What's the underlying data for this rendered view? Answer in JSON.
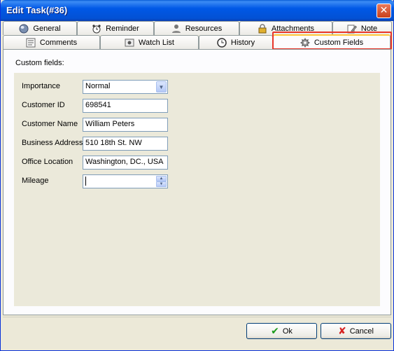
{
  "window": {
    "title": "Edit Task(#36)"
  },
  "tabs_row1": [
    {
      "label": "General",
      "icon": "globe-icon"
    },
    {
      "label": "Reminder",
      "icon": "alarm-clock-icon"
    },
    {
      "label": "Resources",
      "icon": "user-icon"
    },
    {
      "label": "Attachments",
      "icon": "lock-icon"
    },
    {
      "label": "Note",
      "icon": "pencil-icon"
    }
  ],
  "tabs_row2": [
    {
      "label": "Comments",
      "icon": "comments-icon"
    },
    {
      "label": "Watch List",
      "icon": "watchlist-icon"
    },
    {
      "label": "History",
      "icon": "clock-icon"
    },
    {
      "label": "Custom Fields",
      "icon": "gear-icon",
      "active": true
    }
  ],
  "panel": {
    "label": "Custom fields:",
    "fields": [
      {
        "label": "Importance",
        "value": "Normal",
        "type": "dropdown"
      },
      {
        "label": "Customer ID",
        "value": "698541",
        "type": "text"
      },
      {
        "label": "Customer Name",
        "value": "William Peters",
        "type": "text"
      },
      {
        "label": "Business Address",
        "value": "510 18th St. NW",
        "type": "text"
      },
      {
        "label": "Office Location",
        "value": "Washington, DC., USA",
        "type": "text"
      },
      {
        "label": "Mileage",
        "value": "",
        "type": "spinner"
      }
    ]
  },
  "buttons": {
    "ok": "Ok",
    "cancel": "Cancel"
  },
  "colors": {
    "highlight": "#e8352a",
    "title_bar": "#0058e6"
  }
}
